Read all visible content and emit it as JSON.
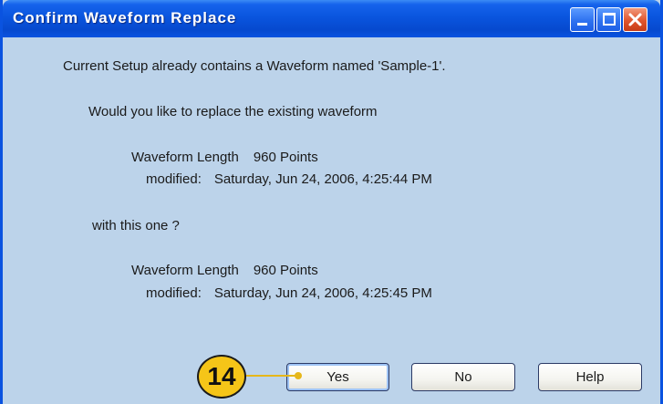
{
  "window": {
    "title": "Confirm Waveform Replace"
  },
  "titlebar_buttons": {
    "minimize_icon": "minimize-icon",
    "maximize_icon": "maximize-icon",
    "close_icon": "close-icon"
  },
  "message": {
    "line1": "Current Setup already contains a Waveform named 'Sample-1'.",
    "line2": "Would you like to replace the existing waveform",
    "existing": {
      "length_label": "Waveform Length",
      "length_value": "960 Points",
      "modified_label": "modified:",
      "modified_value": "Saturday, Jun 24, 2006, 4:25:44 PM"
    },
    "line3": "with this one ?",
    "new": {
      "length_label": "Waveform Length",
      "length_value": "960 Points",
      "modified_label": "modified:",
      "modified_value": "Saturday, Jun 24, 2006, 4:25:45 PM"
    }
  },
  "buttons": {
    "yes": "Yes",
    "no": "No",
    "help": "Help"
  },
  "callout": {
    "number": "14",
    "color": "#f5c518"
  },
  "colors": {
    "titlebar": "#0a55de",
    "body": "#bcd3ea",
    "close_button": "#e0552d"
  }
}
